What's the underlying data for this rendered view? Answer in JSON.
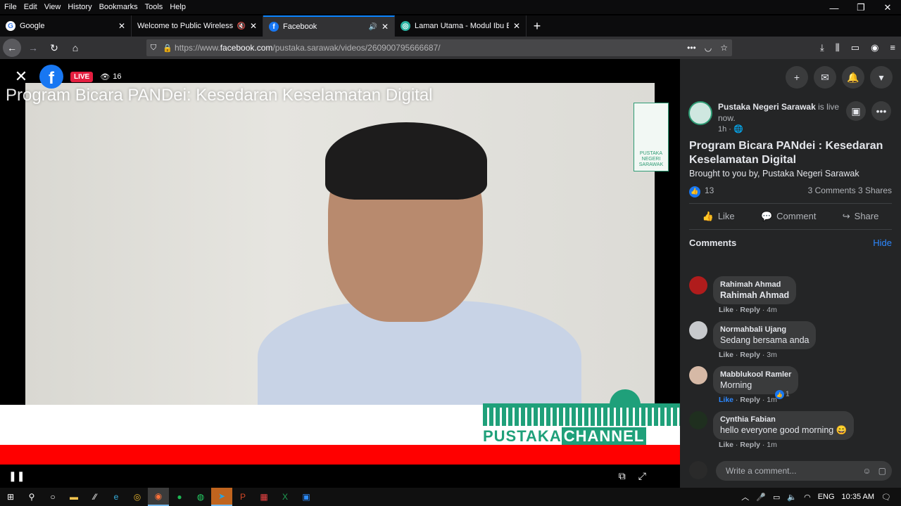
{
  "menu": [
    "File",
    "Edit",
    "View",
    "History",
    "Bookmarks",
    "Tools",
    "Help"
  ],
  "tabs": [
    {
      "title": "Google",
      "icon": "google-icon"
    },
    {
      "title": "Welcome to Public Wireless Net",
      "icon": "wifi-icon"
    },
    {
      "title": "Facebook",
      "icon": "facebook-icon"
    },
    {
      "title": "Laman Utama - Modul Ibu Bap",
      "icon": "site-icon"
    }
  ],
  "url": {
    "prefix": "https://www.",
    "host": "facebook.com",
    "path": "/pustaka.sarawak/videos/260900795666687/"
  },
  "video": {
    "live_label": "LIVE",
    "viewers": "16",
    "overlay_title": "Program Bicara PANDei: Kesedaran Keselamatan Digital",
    "logo_text": [
      "PUSTAKA",
      "NEGERI",
      "SARAWAK"
    ],
    "channel_left": "PUSTAKA",
    "channel_right": "CHANNEL"
  },
  "post": {
    "page_name": "Pustaka Negeri Sarawak",
    "status": " is live now.",
    "time": "1h",
    "title": "Program Bicara PANdei : Kesedaran Keselamatan Digital",
    "description": "Brought to you by, Pustaka Negeri Sarawak",
    "likes": "13",
    "comments_count": "3 Comments",
    "shares_count": "3 Shares",
    "like_label": "Like",
    "comment_label": "Comment",
    "share_label": "Share"
  },
  "comments_header": {
    "title": "Comments",
    "hide": "Hide"
  },
  "comments": [
    {
      "name": "Rahimah Ahmad",
      "text": "Rahimah Ahmad",
      "like": "Like",
      "reply": "Reply",
      "time": "4m",
      "avatar_color": "#b01c1c"
    },
    {
      "name": "Normahbali Ujang",
      "text": "Sedang bersama anda",
      "like": "Like",
      "reply": "Reply",
      "time": "3m",
      "avatar_color": "#c7c9cc"
    },
    {
      "name": "Mabblukool Ramler",
      "text": "Morning",
      "like": "Like",
      "reply": "Reply",
      "time": "1m",
      "reactions": "1",
      "avatar_color": "#d6b9a6"
    },
    {
      "name": "Cynthia Fabian",
      "text": "hello everyone good morning 😄",
      "like": "Like",
      "reply": "Reply",
      "time": "1m",
      "avatar_color": "#1f2f1f"
    }
  ],
  "write_placeholder": "Write a comment...",
  "taskbar": {
    "lang": "ENG",
    "time": "10:35 AM"
  },
  "colors": {
    "accent": "#1877f2",
    "live": "#e41e3f",
    "pustaka_green": "#1fa07a",
    "link": "#2d88ff"
  }
}
